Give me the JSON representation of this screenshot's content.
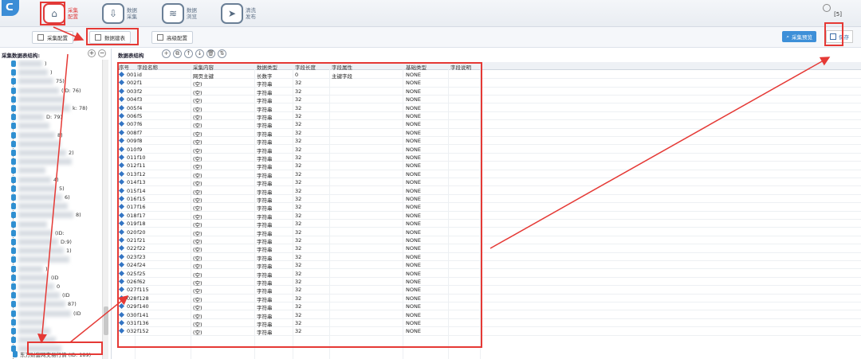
{
  "nav": {
    "items": [
      {
        "label": "采集配置",
        "icon": "home-icon",
        "active": true
      },
      {
        "label": "数据采集",
        "icon": "download-icon",
        "active": false
      },
      {
        "label": "数据浏览",
        "icon": "layers-icon",
        "active": false
      },
      {
        "label": "清洗发布",
        "icon": "send-icon",
        "active": false
      }
    ],
    "count_badge": "[5]"
  },
  "toolbar": {
    "collect_config": "采集配置",
    "data_table": "数据建表",
    "advanced_config": "高级配置",
    "preview": "采集预览",
    "save": "保存"
  },
  "left_panel": {
    "title": "采集数据表结构:",
    "visible_fragments": [
      ")",
      ")",
      "75)",
      "(ID: 76)",
      "",
      "k: 78)",
      "D: 79)",
      "",
      "8)",
      "",
      "2)",
      "",
      "",
      "4)",
      "5)",
      "6)",
      "",
      "8)",
      "",
      "(ID:",
      "D:9)",
      "1)",
      "",
      ")",
      "(ID",
      "0",
      "(ID",
      "87)",
      "(ID",
      "",
      "",
      "",
      ""
    ],
    "last_item": "东方财富网交易行情 (ID: 189)"
  },
  "right_panel": {
    "title": "数据表结构",
    "tools": [
      "+",
      "⧉",
      "↑",
      "↓",
      "🗑",
      "⇅"
    ],
    "columns": [
      "序号",
      "字段名称",
      "采集内容",
      "数据类型",
      "字段长度",
      "字段属性",
      "基础类型",
      "字段说明"
    ],
    "rows": [
      [
        "001",
        "id",
        "网页主键",
        "长数字",
        "0",
        "主键字段",
        "NONE",
        ""
      ],
      [
        "002",
        "f1",
        "(空)",
        "字符串",
        "32",
        "",
        "NONE",
        ""
      ],
      [
        "003",
        "f2",
        "(空)",
        "字符串",
        "32",
        "",
        "NONE",
        ""
      ],
      [
        "004",
        "f3",
        "(空)",
        "字符串",
        "32",
        "",
        "NONE",
        ""
      ],
      [
        "005",
        "f4",
        "(空)",
        "字符串",
        "32",
        "",
        "NONE",
        ""
      ],
      [
        "006",
        "f5",
        "(空)",
        "字符串",
        "32",
        "",
        "NONE",
        ""
      ],
      [
        "007",
        "f6",
        "(空)",
        "字符串",
        "32",
        "",
        "NONE",
        ""
      ],
      [
        "008",
        "f7",
        "(空)",
        "字符串",
        "32",
        "",
        "NONE",
        ""
      ],
      [
        "009",
        "f8",
        "(空)",
        "字符串",
        "32",
        "",
        "NONE",
        ""
      ],
      [
        "010",
        "f9",
        "(空)",
        "字符串",
        "32",
        "",
        "NONE",
        ""
      ],
      [
        "011",
        "f10",
        "(空)",
        "字符串",
        "32",
        "",
        "NONE",
        ""
      ],
      [
        "012",
        "f11",
        "(空)",
        "字符串",
        "32",
        "",
        "NONE",
        ""
      ],
      [
        "013",
        "f12",
        "(空)",
        "字符串",
        "32",
        "",
        "NONE",
        ""
      ],
      [
        "014",
        "f13",
        "(空)",
        "字符串",
        "32",
        "",
        "NONE",
        ""
      ],
      [
        "015",
        "f14",
        "(空)",
        "字符串",
        "32",
        "",
        "NONE",
        ""
      ],
      [
        "016",
        "f15",
        "(空)",
        "字符串",
        "32",
        "",
        "NONE",
        ""
      ],
      [
        "017",
        "f16",
        "(空)",
        "字符串",
        "32",
        "",
        "NONE",
        ""
      ],
      [
        "018",
        "f17",
        "(空)",
        "字符串",
        "32",
        "",
        "NONE",
        ""
      ],
      [
        "019",
        "f18",
        "(空)",
        "字符串",
        "32",
        "",
        "NONE",
        ""
      ],
      [
        "020",
        "f20",
        "(空)",
        "字符串",
        "32",
        "",
        "NONE",
        ""
      ],
      [
        "021",
        "f21",
        "(空)",
        "字符串",
        "32",
        "",
        "NONE",
        ""
      ],
      [
        "022",
        "f22",
        "(空)",
        "字符串",
        "32",
        "",
        "NONE",
        ""
      ],
      [
        "023",
        "f23",
        "(空)",
        "字符串",
        "32",
        "",
        "NONE",
        ""
      ],
      [
        "024",
        "f24",
        "(空)",
        "字符串",
        "32",
        "",
        "NONE",
        ""
      ],
      [
        "025",
        "f25",
        "(空)",
        "字符串",
        "32",
        "",
        "NONE",
        ""
      ],
      [
        "026",
        "f62",
        "(空)",
        "字符串",
        "32",
        "",
        "NONE",
        ""
      ],
      [
        "027",
        "f115",
        "(空)",
        "字符串",
        "32",
        "",
        "NONE",
        ""
      ],
      [
        "028",
        "f128",
        "(空)",
        "字符串",
        "32",
        "",
        "NONE",
        ""
      ],
      [
        "029",
        "f140",
        "(空)",
        "字符串",
        "32",
        "",
        "NONE",
        ""
      ],
      [
        "030",
        "f141",
        "(空)",
        "字符串",
        "32",
        "",
        "NONE",
        ""
      ],
      [
        "031",
        "f136",
        "(空)",
        "字符串",
        "32",
        "",
        "NONE",
        ""
      ],
      [
        "032",
        "f152",
        "(空)",
        "字符串",
        "32",
        "",
        "NONE",
        ""
      ]
    ]
  },
  "colors": {
    "accent": "#3d8fd8",
    "annotation": "#e53935"
  }
}
